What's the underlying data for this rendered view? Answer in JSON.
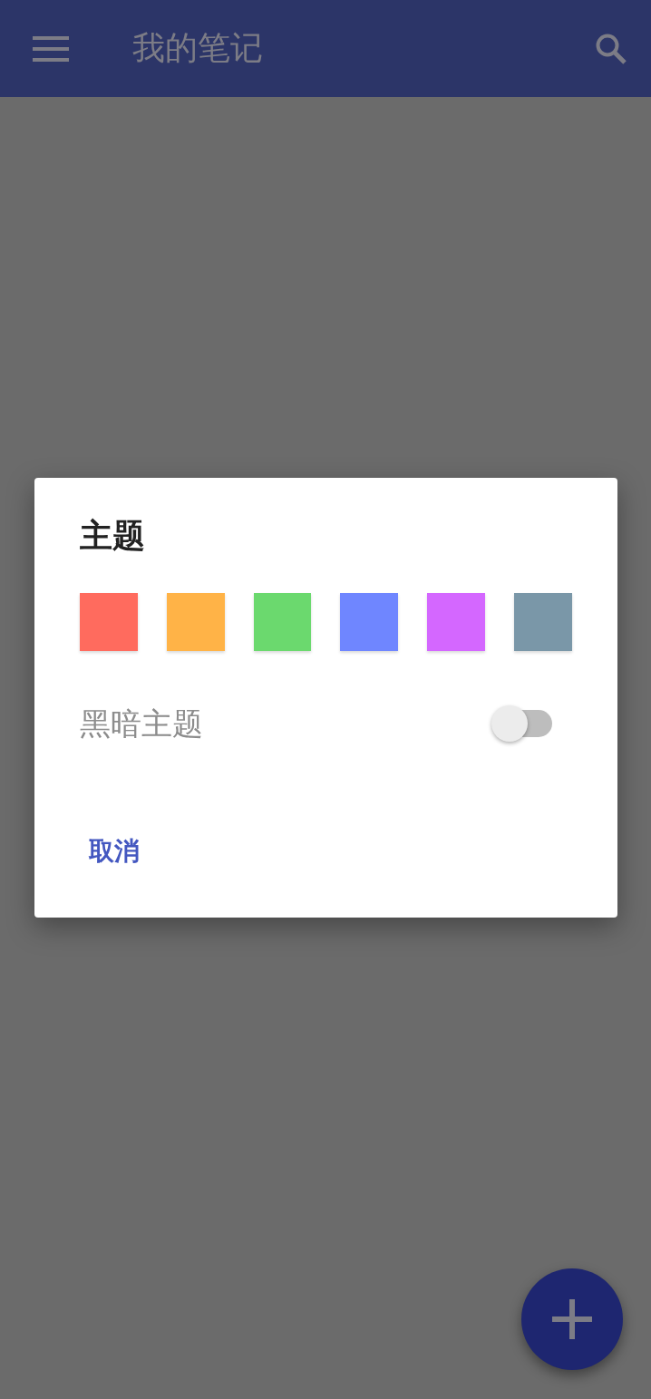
{
  "app_bar": {
    "title": "我的笔记"
  },
  "dialog": {
    "title": "主题",
    "swatches": [
      {
        "color": "#ff6b5e"
      },
      {
        "color": "#ffb347"
      },
      {
        "color": "#6bd96e"
      },
      {
        "color": "#6f86ff"
      },
      {
        "color": "#d467ff"
      },
      {
        "color": "#7a97a8"
      }
    ],
    "dark_theme": {
      "label": "黑暗主题",
      "on": false
    },
    "buttons": [
      "取消"
    ]
  }
}
